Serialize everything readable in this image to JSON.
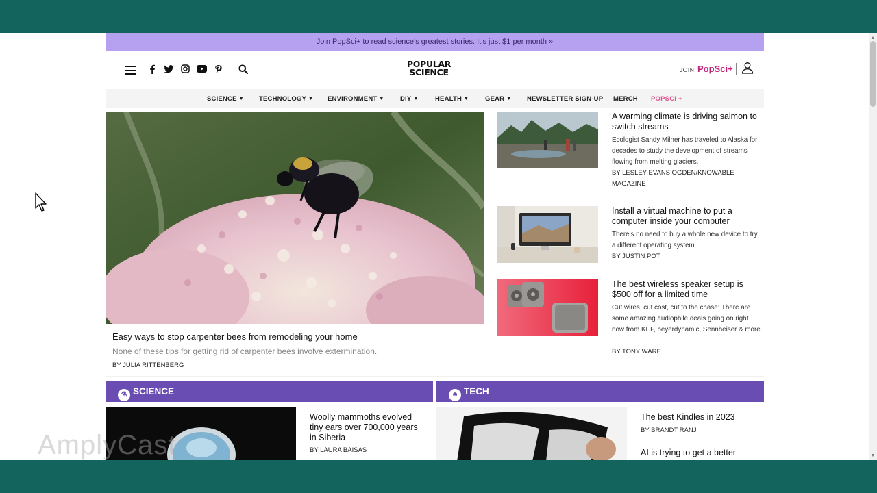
{
  "promo": {
    "text": "Join PopSci+ to read science’s greatest stories.",
    "link": "It’s just $1 per month »"
  },
  "header": {
    "logo_line1": "POPULAR",
    "logo_line2": "SCIENCE",
    "join_label": "JOIN",
    "popsci_plus_label": "PopSci+",
    "icons": [
      "menu-icon",
      "facebook-icon",
      "twitter-icon",
      "instagram-icon",
      "youtube-icon",
      "pinterest-icon",
      "search-icon",
      "user-icon"
    ]
  },
  "nav": {
    "items": [
      {
        "label": "SCIENCE",
        "caret": "▼"
      },
      {
        "label": "TECHNOLOGY",
        "caret": "▼"
      },
      {
        "label": "ENVIRONMENT",
        "caret": "▼"
      },
      {
        "label": "DIY",
        "caret": "▼"
      },
      {
        "label": "HEALTH",
        "caret": "▼"
      },
      {
        "label": "GEAR",
        "caret": "▼"
      },
      {
        "label": "NEWSLETTER SIGN-UP"
      },
      {
        "label": "MERCH"
      },
      {
        "label": "POPSCI +"
      }
    ]
  },
  "hero": {
    "title": "Easy ways to stop carpenter bees from remodeling your home",
    "dek": "None of these tips for getting rid of carpenter bees involve extermination.",
    "byline": "BY JULIA RITTENBERG"
  },
  "stories": [
    {
      "title": "A warming climate is driving salmon to switch streams",
      "dek": "Ecologist Sandy Milner has traveled to Alaska for decades to study the development of streams flowing from melting glaciers.",
      "byline": "BY LESLEY EVANS OGDEN/KNOWABLE MAGAZINE"
    },
    {
      "title": "Install a virtual machine to put a computer inside your computer",
      "dek": "There's no need to buy a whole new device to try a different operating system.",
      "byline": "BY JUSTIN POT"
    },
    {
      "title": "The best wireless speaker setup is $500 off for a limited time",
      "dek": "Cut wires, cut cost, cut to the chase: There are some amazing audiophile deals going on right now from KEF, beyerdynamic, Sennheiser & more.",
      "byline": "BY TONY WARE"
    }
  ],
  "sections": {
    "science": {
      "label": "SCIENCE",
      "story_title": "Woolly mammoths evolved tiny ears over 700,000 years in Siberia",
      "story_byline": "BY LAURA BAISAS"
    },
    "tech": {
      "label": "TECH",
      "story1_title": "The best Kindles in 2023",
      "story1_byline": "BY BRANDT RANJ",
      "story2_title": "AI is trying to get a better"
    }
  },
  "watermark": "AmplyCast",
  "colors": {
    "promo_bg": "#b5a1f0",
    "section_bar": "#6a4db3",
    "popsci_plus": "#c2237a",
    "frame": "#14645e"
  }
}
